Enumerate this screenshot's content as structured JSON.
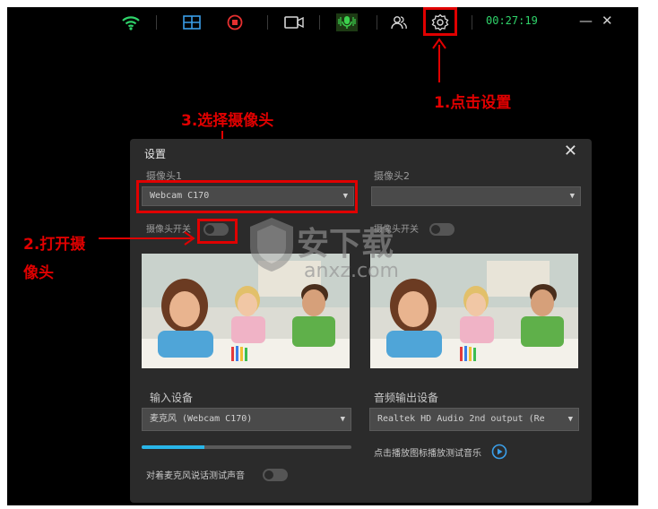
{
  "toolbar": {
    "timer": "00:27:19",
    "minimize": "—",
    "close": "✕"
  },
  "icons": [
    "wifi-icon",
    "layout-grid-icon",
    "record-icon",
    "camera-icon",
    "microphone-icon",
    "users-icon",
    "settings-icon"
  ],
  "annotations": {
    "step1": "1.点击设置",
    "step2_line1": "2.打开摄",
    "step2_line2": "像头",
    "step3": "3.选择摄像头"
  },
  "dialog": {
    "title": "设置",
    "close": "✕",
    "camera1_label": "摄像头1",
    "camera1_value": "Webcam C170",
    "camera2_label": "摄像头2",
    "camera2_value": "",
    "camera_switch_label": "摄像头开关",
    "camera2_switch_label": "摄像头开关",
    "input_device_label": "输入设备",
    "input_device_value": "麦克风 (Webcam C170)",
    "output_device_label": "音频输出设备",
    "output_device_value": "Realtek HD Audio 2nd output (Re",
    "mic_test_label": "对着麦克风说话测试声音",
    "play_test_label": "点击播放图标播放测试音乐",
    "mic_level": 0.3
  },
  "watermark": {
    "text": "安下载",
    "url": "anxz.com"
  },
  "colors": {
    "accent_red": "#e00000",
    "timer_green": "#2fd36a",
    "progress_blue": "#29b6e8",
    "icon_blue": "#3a9ee8"
  }
}
